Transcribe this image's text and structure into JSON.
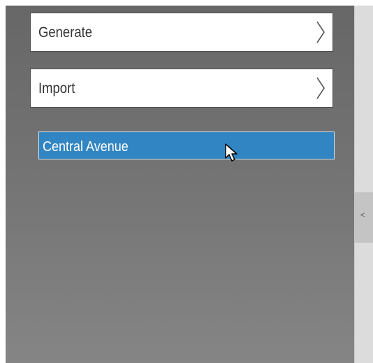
{
  "menu": {
    "generate_label": "Generate",
    "import_label": "Import"
  },
  "list": {
    "items": [
      {
        "label": "Central Avenue",
        "selected": true
      }
    ]
  },
  "side_panel": {
    "collapse_glyph": "<"
  },
  "icons": {
    "generate_chevron": "chevron-right-icon",
    "import_chevron": "chevron-right-icon",
    "cursor": "mouse-pointer-icon"
  },
  "colors": {
    "selected_item": "#3285c3",
    "panel_top": "#676767",
    "panel_bottom": "#858585"
  }
}
